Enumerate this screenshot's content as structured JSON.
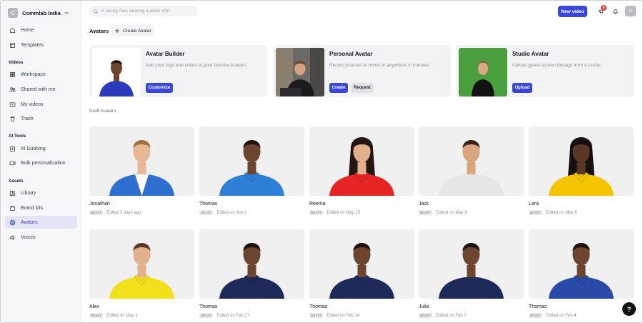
{
  "workspace": {
    "initial": "C",
    "name": "Commlab India"
  },
  "sidebar": {
    "items_top": [
      {
        "label": "Home",
        "icon": "home-icon"
      },
      {
        "label": "Templates",
        "icon": "templates-icon"
      }
    ],
    "sections": [
      {
        "title": "Videos",
        "items": [
          {
            "label": "Workspace",
            "icon": "workspace-icon"
          },
          {
            "label": "Shared with me",
            "icon": "shared-icon"
          },
          {
            "label": "My videos",
            "icon": "video-icon"
          },
          {
            "label": "Trash",
            "icon": "trash-icon"
          }
        ]
      },
      {
        "title": "AI Tools",
        "items": [
          {
            "label": "AI Dubbing",
            "icon": "dubbing-icon"
          },
          {
            "label": "Bulk personalization",
            "icon": "bulk-icon"
          }
        ]
      },
      {
        "title": "Assets",
        "items": [
          {
            "label": "Library",
            "icon": "library-icon"
          },
          {
            "label": "Brand kits",
            "icon": "brand-kit-icon"
          },
          {
            "label": "Avatars",
            "icon": "avatar-icon",
            "active": true
          },
          {
            "label": "Voices",
            "icon": "voice-icon"
          }
        ]
      }
    ]
  },
  "topbar": {
    "search_placeholder": "A young man wearing a white shirt",
    "new_video_label": "New video",
    "notification_count": "8",
    "user_initials": "CI"
  },
  "page": {
    "title": "Avatars",
    "create_label": "Create Avatar",
    "draft_section_label": "Draft Avatars"
  },
  "features": [
    {
      "title": "Avatar Builder",
      "desc": "Add your logo and colors to your favorite Avatars",
      "buttons": [
        "Customize"
      ]
    },
    {
      "title": "Personal Avatar",
      "desc": "Record yourself at home or anywhere in minutes",
      "buttons": [
        "Create",
        "Request"
      ]
    },
    {
      "title": "Studio Avatar",
      "desc": "Upload green-screen footage from a studio",
      "buttons": [
        "Upload"
      ]
    }
  ],
  "avatars": [
    {
      "name": "Jonathan",
      "edited": "Edited 3 days ago",
      "badge": "DRAFT",
      "skin": "#e8b896",
      "hair": "#a0713e",
      "shirt": "#2f6fd0",
      "inner": "#ffffff",
      "collar": "blazer",
      "longhair": false
    },
    {
      "name": "Thomas",
      "edited": "Edited on Jun 2",
      "badge": "DRAFT",
      "skin": "#6b4530",
      "hair": "#1d120c",
      "shirt": "#2e7fd6",
      "inner": "#2e7fd6",
      "collar": "polo",
      "longhair": false
    },
    {
      "name": "Reema",
      "edited": "Edited on May 15",
      "badge": "DRAFT",
      "skin": "#e0b08a",
      "hair": "#241713",
      "shirt": "#e52423",
      "inner": "#e52423",
      "collar": "polo",
      "longhair": true
    },
    {
      "name": "Jack",
      "edited": "Edited on May 6",
      "badge": "DRAFT",
      "skin": "#d9a57f",
      "hair": "#3a2418",
      "shirt": "#e6e6e6",
      "inner": "#e6e6e6",
      "collar": "tee",
      "longhair": false
    },
    {
      "name": "Lara",
      "edited": "Edited on May 6",
      "badge": "DRAFT",
      "skin": "#5a3826",
      "hair": "#171010",
      "shirt": "#f5c400",
      "inner": "#f5c400",
      "collar": "polo",
      "longhair": true
    },
    {
      "name": "Alex",
      "edited": "Edited on May 2",
      "badge": "DRAFT",
      "skin": "#e3b08e",
      "hair": "#5a3a22",
      "shirt": "#f2e01c",
      "inner": "#f2e01c",
      "collar": "polo",
      "longhair": false
    },
    {
      "name": "Thomas",
      "edited": "Edited on Feb 27",
      "badge": "DRAFT",
      "skin": "#6b4530",
      "hair": "#1d120c",
      "shirt": "#1e2a5a",
      "inner": "#1e2a5a",
      "collar": "polo",
      "longhair": false
    },
    {
      "name": "Thomas",
      "edited": "Edited on Feb 14",
      "badge": "DRAFT",
      "skin": "#6b4530",
      "hair": "#1d120c",
      "shirt": "#1e2a5a",
      "inner": "#1e2a5a",
      "collar": "polo",
      "longhair": false
    },
    {
      "name": "Julia",
      "edited": "Edited on Feb 7",
      "badge": "DRAFT",
      "skin": "#6e4630",
      "hair": "#1e1410",
      "shirt": "#1e2a5a",
      "inner": "#1e2a5a",
      "collar": "tee",
      "longhair": false
    },
    {
      "name": "Thomas",
      "edited": "Edited on Feb 4",
      "badge": "DRAFT",
      "skin": "#6b4530",
      "hair": "#1d120c",
      "shirt": "#2a4aa8",
      "inner": "#2a4aa8",
      "collar": "polo",
      "longhair": false
    }
  ],
  "colors": {
    "accent": "#3b47d6",
    "active_bg": "#e3e5f7",
    "badge_red": "#e23b3b"
  },
  "help_label": "?"
}
